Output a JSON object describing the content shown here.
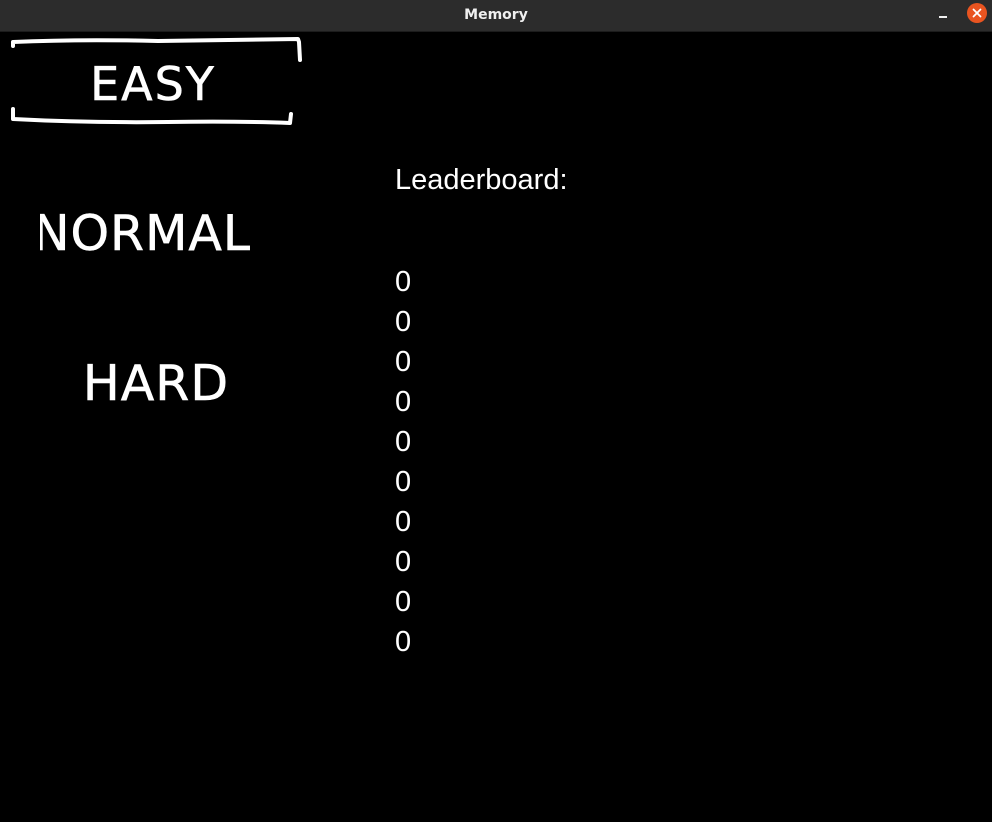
{
  "window": {
    "title": "Memory",
    "controls": [
      "minimize-icon",
      "close-icon"
    ],
    "close_color": "#e95420"
  },
  "menu": {
    "options": [
      {
        "label": "EASY",
        "selected": true
      },
      {
        "label": "NORMAL",
        "selected": false
      },
      {
        "label": "HARD",
        "selected": false
      }
    ]
  },
  "leaderboard": {
    "title": "Leaderboard:",
    "scores": [
      "0",
      "0",
      "0",
      "0",
      "0",
      "0",
      "0",
      "0",
      "0",
      "0"
    ]
  },
  "colors": {
    "background": "#000000",
    "foreground": "#ffffff",
    "titlebar": "#2c2c2c"
  }
}
